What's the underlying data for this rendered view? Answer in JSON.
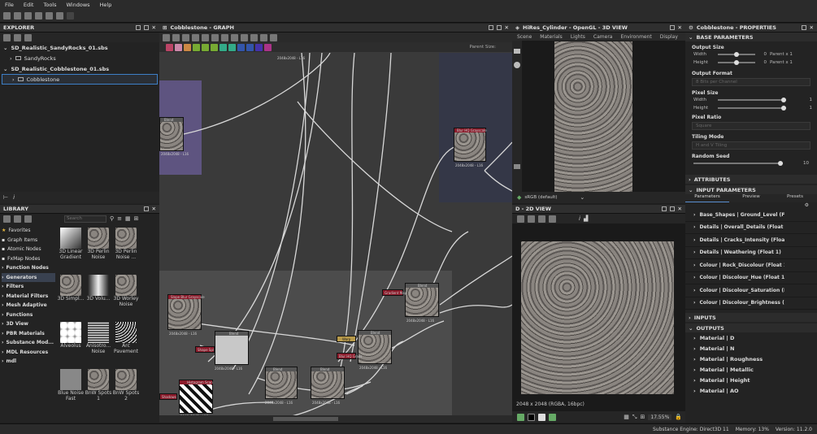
{
  "menu": [
    "File",
    "Edit",
    "Tools",
    "Windows",
    "Help"
  ],
  "explorer": {
    "title": "EXPLORER",
    "items": [
      {
        "label": "SD_Realistic_SandyRocks_01.sbs",
        "level": 0,
        "bold": true
      },
      {
        "label": "SandyRocks",
        "level": 1,
        "bold": false
      },
      {
        "label": "SD_Realistic_Cobblestone_01.sbs",
        "level": 0,
        "bold": true
      },
      {
        "label": "Cobblestone",
        "level": 1,
        "bold": false
      }
    ]
  },
  "library": {
    "title": "LIBRARY",
    "search_placeholder": "Search",
    "categories": [
      "Favorites",
      "Graph Items",
      "Atomic Nodes",
      "FxMap Nodes",
      "Function Nodes",
      "Generators",
      "Filters",
      "Material Filters",
      "Mesh Adaptive",
      "Functions",
      "3D View",
      "PBR Materials",
      "Substance Mod...",
      "MDL Resources",
      "mdl"
    ],
    "thumbs": [
      {
        "label": "3D Linear Gradient"
      },
      {
        "label": "3D Perlin Noise"
      },
      {
        "label": "3D Perlin Noise ..."
      },
      {
        "label": "3D Simpl..."
      },
      {
        "label": "3D Volu..."
      },
      {
        "label": "3D Worley Noise"
      },
      {
        "label": "Alveolus"
      },
      {
        "label": "Anisotro... Noise"
      },
      {
        "label": "Arc Pavement"
      },
      {
        "label": "Blue Noise Fast"
      },
      {
        "label": "BnW Spots 1"
      },
      {
        "label": "BnW Spots 2"
      }
    ]
  },
  "graph": {
    "title": "Cobblestone - GRAPH",
    "parent_size": "Parent Size:",
    "res": "2048x2048 - L16",
    "nodes": {
      "blend": "Blend",
      "blur": "Blur HQ Grayscale",
      "slope": "Slope Blur Grayscale",
      "histogram": "Histogram Scan",
      "gradient": "Gradient Map",
      "warp": "Warp",
      "blur2": "Blur HQ Grays",
      "shape": "Shape Spl",
      "shadows": "Shadows"
    }
  },
  "view3d": {
    "title": "HiRes_Cylinder - OpenGL - 3D VIEW",
    "tabs": [
      "Scene",
      "Materials",
      "Lights",
      "Camera",
      "Environment",
      "Display"
    ],
    "colorspace": "sRGB (default)"
  },
  "view2d": {
    "title": "D - 2D VIEW",
    "info": "2048 x 2048 (RGBA, 16bpc)",
    "zoom": "17.55%"
  },
  "properties": {
    "title": "Cobblestone - PROPERTIES",
    "base_parameters": "BASE PARAMETERS",
    "output_size": "Output Size",
    "width": "Width",
    "height": "Height",
    "zero": "0",
    "parent_x1": "Parent x 1",
    "output_format": "Output Format",
    "output_format_value": "8 Bits per Channel",
    "pixel_size": "Pixel Size",
    "one": "1",
    "pixel_ratio": "Pixel Ratio",
    "pixel_ratio_value": "Square",
    "tiling_mode": "Tiling Mode",
    "tiling_mode_value": "H and V Tiling",
    "random_seed": "Random Seed",
    "ten": "10",
    "attributes": "ATTRIBUTES",
    "input_parameters": "INPUT PARAMETERS",
    "subtabs": [
      "Parameters",
      "Preview",
      "Presets"
    ],
    "params": [
      "Base_Shapes | Ground_Level (Float 1)",
      "Details | Overall_Details (Float 1)",
      "Details | Cracks_Intensity (Float 1)",
      "Details | Weathering (Float 1)",
      "Colour | Rock_Discolour (Float 1)",
      "Colour | Discolour_Hue (Float 1)",
      "Colour | Discolour_Saturation (Float 1)",
      "Colour | Discolour_Brightness (Float 1)"
    ],
    "inputs": "INPUTS",
    "outputs": "OUTPUTS",
    "output_items": [
      "Material | D",
      "Material | N",
      "Material | Roughness",
      "Material | Metallic",
      "Material | Height",
      "Material | AO"
    ]
  },
  "status": {
    "engine": "Substance Engine: Direct3D 11",
    "memory": "Memory: 13%",
    "version": "Version: 11.2.0"
  }
}
